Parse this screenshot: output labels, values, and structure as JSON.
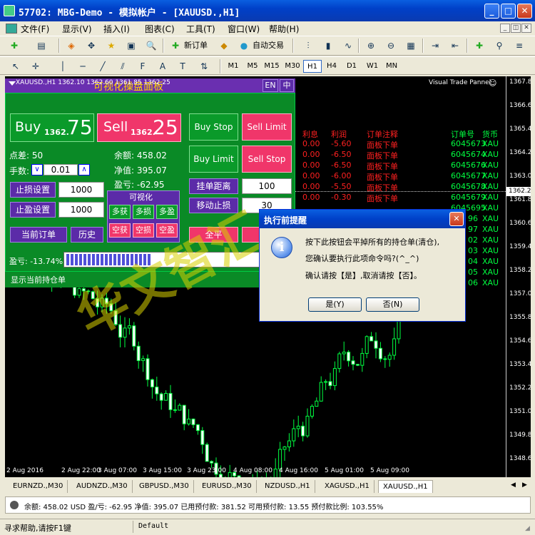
{
  "window": {
    "title": "57702: MBG-Demo - 模拟帐户 - [XAUUSD.,H1]"
  },
  "menu": [
    "文件(F)",
    "显示(V)",
    "插入(I)",
    "图表(C)",
    "工具(T)",
    "窗口(W)",
    "帮助(H)"
  ],
  "toolbar": {
    "new_order": "新订单",
    "auto_trading": "自动交易"
  },
  "timeframes": [
    "M1",
    "M5",
    "M15",
    "M30",
    "H1",
    "H4",
    "D1",
    "W1",
    "MN"
  ],
  "timeframe_selected": "H1",
  "chart": {
    "info": "XAUUSD.,H1  1362.10 1362.60 1361.85 1362.25",
    "panel_name": "Visual Trade Pannel",
    "prices": [
      "1367.80",
      "1366.60",
      "1365.40",
      "1364.20",
      "1363.00",
      "1361.80",
      "1360.60",
      "1359.45",
      "1358.25",
      "1357.00",
      "1355.80",
      "1354.60",
      "1353.40",
      "1352.20",
      "1351.00",
      "1349.80",
      "1348.60"
    ],
    "current_price": "1362.25",
    "times": [
      "2 Aug 2016",
      "2 Aug 22:00",
      "3 Aug 07:00",
      "3 Aug 15:00",
      "3 Aug 23:00",
      "4 Aug 08:00",
      "4 Aug 16:00",
      "5 Aug 01:00",
      "5 Aug 09:00"
    ]
  },
  "panel": {
    "title": "可视化操盘面板",
    "lang_en": "EN",
    "lang_cn": "中",
    "buy_label": "Buy",
    "buy_price_small": "1362.",
    "buy_price_big": "75",
    "sell_label": "Sell",
    "sell_price_small": "1362.",
    "sell_price_big": "25",
    "buy_stop": "Buy Stop",
    "sell_limit": "Sell Limit",
    "buy_limit": "Buy Limit",
    "sell_stop": "Sell Stop",
    "spread_label": "点差: 50",
    "balance_label": "余额: 458.02",
    "lots_label": "手数:",
    "lots_value": "0.01",
    "equity_label": "净值: 395.07",
    "profit_label": "盈亏: -62.95",
    "sl_button": "止损设置",
    "sl_value": "1000",
    "tp_button": "止盈设置",
    "tp_value": "1000",
    "pending_dist": "挂单距离",
    "pending_value": "100",
    "trailing": "移动止损",
    "trailing_value": "30",
    "visual_label": "可视化",
    "grid_buttons": [
      "多获",
      "多损",
      "多盈",
      "空获",
      "空损",
      "空盈"
    ],
    "current_orders": "当前订单",
    "history": "历史",
    "close_all": "全平",
    "pl_label": "盈亏: -13.74%",
    "show_positions": "显示当前持仓单"
  },
  "orders": {
    "headers": [
      "利息",
      "利润",
      "订单注释",
      "订单号",
      "货币"
    ],
    "rows": [
      [
        "0.00",
        "-5.60",
        "面板下单",
        "6045673",
        "XAU"
      ],
      [
        "0.00",
        "-6.50",
        "面板下单",
        "6045674",
        "XAU"
      ],
      [
        "0.00",
        "-6.50",
        "面板下单",
        "6045676",
        "XAU"
      ],
      [
        "0.00",
        "-6.00",
        "面板下单",
        "6045677",
        "XAU"
      ],
      [
        "0.00",
        "-5.50",
        "面板下单",
        "6045678",
        "XAU"
      ],
      [
        "0.00",
        "-0.30",
        "面板下单",
        "6045679",
        "XAU"
      ]
    ],
    "partial_rows": [
      "6045695",
      "96",
      "97",
      "02",
      "03",
      "04",
      "05",
      "06"
    ],
    "partial_xau": [
      "XAU",
      "XAU",
      "XAU",
      "XAU",
      "XAU",
      "XAU",
      "XAU",
      "XAU"
    ]
  },
  "dialog": {
    "title": "执行前提醒",
    "line1": "按下此按钮会平掉所有的持仓单(清仓),",
    "line2": "您确认要执行此项命令吗?(^_^)",
    "line3": "确认请按【是】,取消请按【否】。",
    "yes": "是(Y)",
    "no": "否(N)"
  },
  "tabs": [
    "EURNZD.,M30",
    "AUDNZD.,M30",
    "GBPUSD.,M30",
    "EURUSD.,M30",
    "NZDUSD.,H1",
    "XAGUSD.,H1",
    "XAUUSD.,H1"
  ],
  "tab_active": "XAUUSD.,H1",
  "account": "余额: 458.02 USD  盈/亏: -62.95  净值: 395.07  已用预付款: 381.52  可用预付款: 13.55  预付款比例: 103.55%",
  "status": {
    "help": "寻求帮助,请按F1键",
    "profile": "Default"
  },
  "watermark": "华文智汇",
  "colors": {
    "chart_bg": "#000000",
    "bull": "#ffffff",
    "bear": "#00ff40",
    "panel_header": "#6a2fb0"
  }
}
